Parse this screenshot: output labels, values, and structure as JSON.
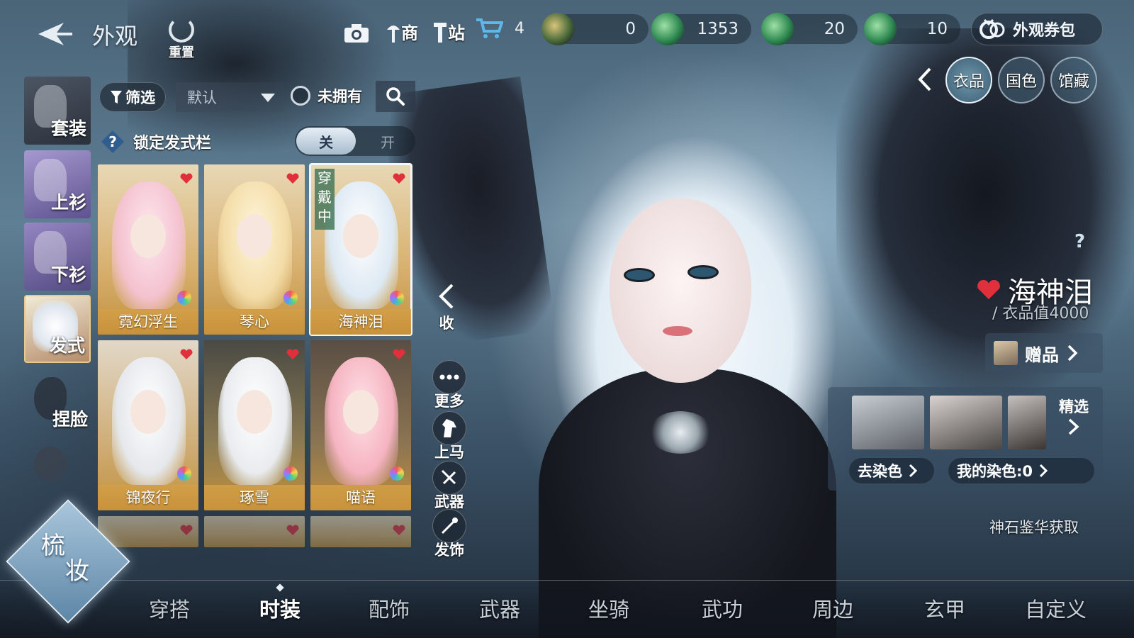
{
  "header": {
    "title": "外观",
    "reset_label": "重置",
    "shop_label": "商",
    "station_label": "站",
    "cart_count": "4",
    "currencies": [
      "0",
      "1353",
      "20",
      "10"
    ],
    "coupon_label": "外观券包"
  },
  "rail": {
    "suit": "套装",
    "top": "上衫",
    "bottom": "下衫",
    "hair": "发式",
    "face": "捏脸"
  },
  "filters": {
    "filter_label": "筛选",
    "sort_value": "默认",
    "owned_label": "未拥有",
    "lock_label": "锁定发式栏",
    "lock_off": "关",
    "lock_on": "开"
  },
  "grid": {
    "wearing_badge": "穿戴中",
    "items": [
      {
        "name": "霓幻浮生"
      },
      {
        "name": "琴心"
      },
      {
        "name": "海神泪"
      },
      {
        "name": "锦夜行"
      },
      {
        "name": "琢雪"
      },
      {
        "name": "喵语"
      }
    ]
  },
  "actions": {
    "collapse": "收",
    "more": "更多",
    "mount": "上马",
    "weapon": "武器",
    "hair_acc": "发饰"
  },
  "right_panel": {
    "tabs": [
      "衣品",
      "国色",
      "馆藏"
    ],
    "item_name": "海神泪",
    "item_value": "/ 衣品值4000",
    "gift_label": "赠品",
    "dye_select_label": "精选",
    "dye_remove_label": "去染色",
    "dye_mine_label": "我的染色:0",
    "source_text": "神石鉴华获取"
  },
  "bottom_tabs": [
    "穿搭",
    "时装",
    "配饰",
    "武器",
    "坐骑",
    "武功",
    "周边",
    "玄甲",
    "自定义"
  ],
  "makeup": {
    "line1": "梳",
    "line2": "妆"
  },
  "colors": {
    "accent_gold": "#c8923a",
    "heart_red": "#e0303c",
    "panel_blue": "#3c5d73"
  }
}
